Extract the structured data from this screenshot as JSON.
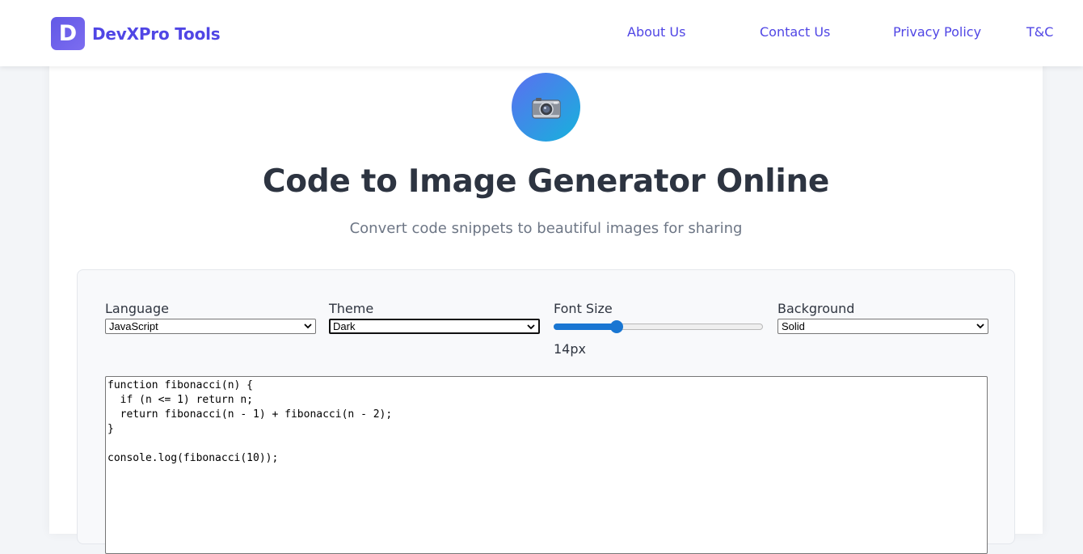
{
  "header": {
    "logo_letter": "D",
    "brand": "DevXPro Tools",
    "nav": [
      {
        "label": "About Us"
      },
      {
        "label": "Contact Us"
      },
      {
        "label": "Privacy Policy"
      },
      {
        "label": "T&C"
      }
    ]
  },
  "hero": {
    "icon": "camera-icon",
    "title": "Code to Image Generator Online",
    "subtitle": "Convert code snippets to beautiful images for sharing"
  },
  "controls": {
    "language": {
      "label": "Language",
      "value": "JavaScript"
    },
    "theme": {
      "label": "Theme",
      "value": "Dark"
    },
    "font_size": {
      "label": "Font Size",
      "value_text": "14px",
      "fill_fraction": 0.3
    },
    "background": {
      "label": "Background",
      "value": "Solid"
    }
  },
  "editor": {
    "code": "function fibonacci(n) {\n  if (n <= 1) return n;\n  return fibonacci(n - 1) + fibonacci(n - 2);\n}\n\nconsole.log(fibonacci(10));"
  },
  "colors": {
    "brand": "#5046e5",
    "hero_gradient_start": "#5b6ff0",
    "hero_gradient_end": "#16b2dc",
    "slider": "#1976d2",
    "title": "#2d3441"
  }
}
